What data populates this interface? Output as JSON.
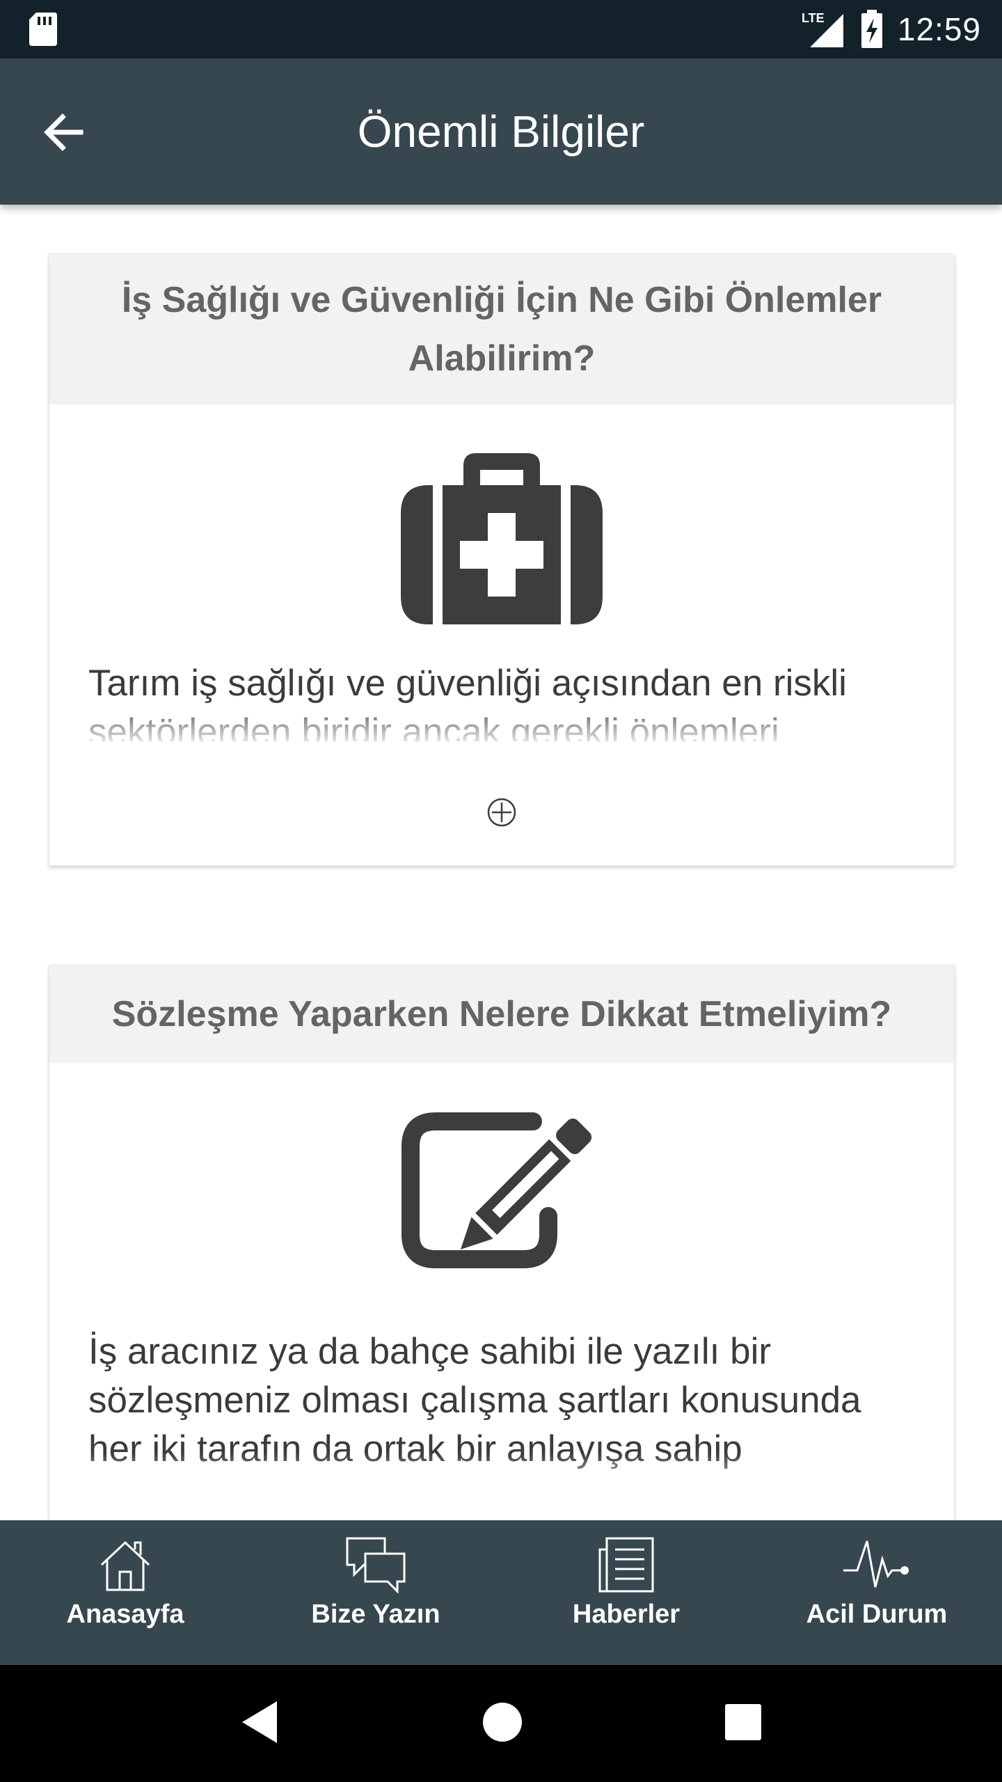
{
  "status_bar": {
    "time": "12:59",
    "network": "LTE",
    "icons": [
      "sd-card-icon",
      "signal-icon",
      "battery-charging-icon"
    ]
  },
  "app_bar": {
    "title": "Önemli Bilgiler",
    "back_icon": "arrow-back-icon"
  },
  "cards": [
    {
      "title": "İş Sağlığı ve Güvenliği İçin Ne Gibi Önlemler Alabilirim?",
      "icon": "medical-kit-icon",
      "text": "Tarım iş sağlığı ve güvenliği açısından en riskli sektörlerden biridir ancak gerekli önlemleri",
      "expand_icon": "plus-circle-icon"
    },
    {
      "title": "Sözleşme Yaparken Nelere Dikkat Etmeliyim?",
      "icon": "edit-icon",
      "text": "İş aracınız ya da bahçe sahibi ile yazılı bir sözleşmeniz olması çalışma şartları konusunda her iki tarafın da ortak bir anlayışa sahip"
    }
  ],
  "bottom_nav": {
    "items": [
      {
        "label": "Anasayfa",
        "icon": "home-icon"
      },
      {
        "label": "Bize Yazın",
        "icon": "chat-icon"
      },
      {
        "label": "Haberler",
        "icon": "news-icon"
      },
      {
        "label": "Acil Durum",
        "icon": "heartbeat-icon"
      }
    ]
  },
  "system_nav": {
    "icons": [
      "back-triangle-icon",
      "home-circle-icon",
      "recents-square-icon"
    ]
  },
  "colors": {
    "status_bar": "#13212a",
    "app_bar": "#37474f",
    "card_header_bg": "#f2f2f2",
    "card_header_text": "#646464",
    "icon_dark": "#3d3d3d"
  }
}
